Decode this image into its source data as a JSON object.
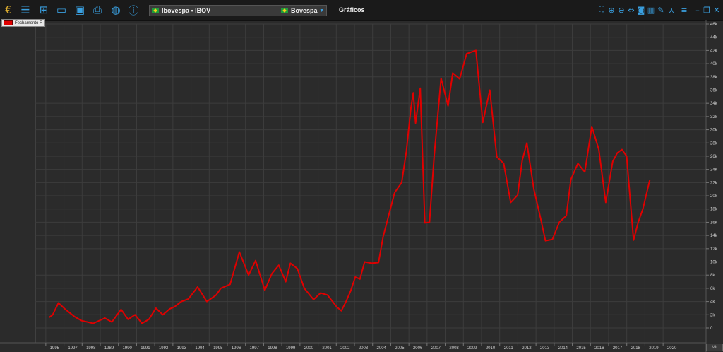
{
  "toolbar": {
    "symbol_label": "Ibovespa • IBOV",
    "exchange_label": "Bovespa",
    "tab_label": "Gráficos",
    "left_icons": [
      "logo-icon",
      "menu-icon",
      "new-chart-icon",
      "open-folder-icon",
      "save-icon",
      "print-icon",
      "globe-icon",
      "help-icon"
    ],
    "right_icons": [
      "fullscreen-icon",
      "zoom-in-icon",
      "zoom-out-icon",
      "fit-width-icon",
      "screenshot-icon",
      "indicator-icon",
      "drawing-icon",
      "line-tool-icon",
      "settings-icon",
      "minimize-icon",
      "restore-icon",
      "close-icon"
    ]
  },
  "legend": {
    "label": "Fechamento F"
  },
  "axis_badge": "Mlt",
  "colors": {
    "background": "#2b2b2b",
    "grid": "#3d3d3d",
    "line": "#e00000",
    "axis_text": "#cfcfcf"
  },
  "chart_data": {
    "type": "line",
    "series": [
      {
        "name": "Fechamento F",
        "x": [
          1995.6,
          1995.75,
          1996.0,
          1996.3,
          1996.7,
          1997.0,
          1997.5,
          1998.0,
          1998.3,
          1998.7,
          1999.0,
          1999.3,
          1999.6,
          1999.9,
          2000.2,
          2000.5,
          2000.8,
          2001.0,
          2001.3,
          2001.6,
          2002.0,
          2002.4,
          2002.8,
          2003.0,
          2003.4,
          2003.8,
          2004.2,
          2004.5,
          2004.9,
          2005.2,
          2005.5,
          2005.8,
          2006.0,
          2006.3,
          2006.6,
          2007.0,
          2007.3,
          2007.6,
          2008.0,
          2008.2,
          2008.4,
          2008.6,
          2008.8,
          2009.0,
          2009.2,
          2009.5,
          2009.8,
          2010.0,
          2010.2,
          2010.5,
          2010.8,
          2011.0,
          2011.2,
          2011.3,
          2011.4,
          2011.6,
          2011.8,
          2012.0,
          2012.2,
          2012.5,
          2012.8,
          2013.0,
          2013.3,
          2013.6,
          2014.0,
          2014.3,
          2014.6,
          2014.9,
          2015.2,
          2015.5,
          2015.8,
          2016.0,
          2016.2,
          2016.5,
          2016.8,
          2017.0,
          2017.3,
          2017.6,
          2017.9,
          2018.1,
          2018.4,
          2018.7,
          2019.0,
          2019.3,
          2019.6,
          2019.9,
          2020.1,
          2020.3,
          2020.5,
          2020.8,
          2021.0,
          2021.2,
          2021.5
        ],
        "values": [
          1600,
          2000,
          3800,
          2800,
          1700,
          1100,
          700,
          1500,
          900,
          2800,
          1300,
          2000,
          700,
          1300,
          3000,
          2000,
          2900,
          3200,
          4000,
          4400,
          6200,
          4000,
          5000,
          6000,
          6600,
          11500,
          8000,
          10200,
          5700,
          8200,
          9500,
          7000,
          9800,
          9000,
          6000,
          4300,
          5300,
          5000,
          3200,
          2600,
          4000,
          5600,
          7700,
          7400,
          10000,
          9800,
          9900,
          13800,
          16500,
          20500,
          22000,
          26700,
          33300,
          35600,
          31000,
          36300,
          15900,
          16000,
          26000,
          37800,
          33600,
          38600,
          37700,
          41500,
          42000,
          31100,
          36000,
          25900,
          24900,
          19000,
          20100,
          25400,
          28000,
          21000,
          16500,
          13200,
          13400,
          16000,
          17000,
          22500,
          24900,
          23600,
          30500,
          27000,
          19000,
          25200,
          26500,
          27000,
          26000,
          13300,
          16000,
          18000,
          22400
        ]
      }
    ],
    "yticks": [
      "0",
      "2k",
      "4k",
      "6k",
      "8k",
      "10k",
      "12k",
      "14k",
      "16k",
      "18k",
      "20k",
      "22k",
      "24k",
      "26k",
      "28k",
      "30k",
      "32k",
      "34k",
      "36k",
      "38k",
      "40k",
      "42k",
      "44k",
      "46k"
    ],
    "xticks": [
      "1995",
      "1997",
      "1998",
      "1989",
      "1990",
      "1991",
      "1992",
      "1993",
      "1994",
      "1995",
      "1996",
      "1997",
      "1998",
      "1999",
      "2000",
      "2001",
      "2002",
      "2003",
      "2004",
      "2005",
      "2006",
      "2007",
      "2008",
      "2009",
      "2010",
      "2011",
      "2012",
      "2013",
      "2014",
      "2015",
      "2016",
      "2017",
      "2018",
      "2019",
      "2020"
    ],
    "ylim": [
      0,
      46000
    ],
    "xlim": [
      1995.0,
      2022.8
    ],
    "grid": true,
    "legend_position": "top-left"
  }
}
